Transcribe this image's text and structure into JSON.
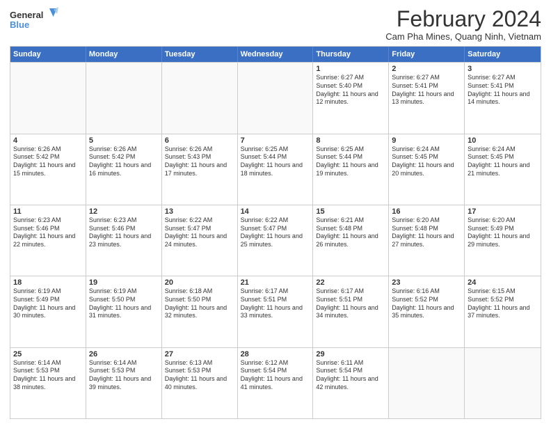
{
  "logo": {
    "line1": "General",
    "line2": "Blue"
  },
  "title": "February 2024",
  "location": "Cam Pha Mines, Quang Ninh, Vietnam",
  "days_of_week": [
    "Sunday",
    "Monday",
    "Tuesday",
    "Wednesday",
    "Thursday",
    "Friday",
    "Saturday"
  ],
  "weeks": [
    [
      {
        "day": "",
        "info": ""
      },
      {
        "day": "",
        "info": ""
      },
      {
        "day": "",
        "info": ""
      },
      {
        "day": "",
        "info": ""
      },
      {
        "day": "1",
        "sunrise": "Sunrise: 6:27 AM",
        "sunset": "Sunset: 5:40 PM",
        "daylight": "Daylight: 11 hours and 12 minutes."
      },
      {
        "day": "2",
        "sunrise": "Sunrise: 6:27 AM",
        "sunset": "Sunset: 5:41 PM",
        "daylight": "Daylight: 11 hours and 13 minutes."
      },
      {
        "day": "3",
        "sunrise": "Sunrise: 6:27 AM",
        "sunset": "Sunset: 5:41 PM",
        "daylight": "Daylight: 11 hours and 14 minutes."
      }
    ],
    [
      {
        "day": "4",
        "sunrise": "Sunrise: 6:26 AM",
        "sunset": "Sunset: 5:42 PM",
        "daylight": "Daylight: 11 hours and 15 minutes."
      },
      {
        "day": "5",
        "sunrise": "Sunrise: 6:26 AM",
        "sunset": "Sunset: 5:42 PM",
        "daylight": "Daylight: 11 hours and 16 minutes."
      },
      {
        "day": "6",
        "sunrise": "Sunrise: 6:26 AM",
        "sunset": "Sunset: 5:43 PM",
        "daylight": "Daylight: 11 hours and 17 minutes."
      },
      {
        "day": "7",
        "sunrise": "Sunrise: 6:25 AM",
        "sunset": "Sunset: 5:44 PM",
        "daylight": "Daylight: 11 hours and 18 minutes."
      },
      {
        "day": "8",
        "sunrise": "Sunrise: 6:25 AM",
        "sunset": "Sunset: 5:44 PM",
        "daylight": "Daylight: 11 hours and 19 minutes."
      },
      {
        "day": "9",
        "sunrise": "Sunrise: 6:24 AM",
        "sunset": "Sunset: 5:45 PM",
        "daylight": "Daylight: 11 hours and 20 minutes."
      },
      {
        "day": "10",
        "sunrise": "Sunrise: 6:24 AM",
        "sunset": "Sunset: 5:45 PM",
        "daylight": "Daylight: 11 hours and 21 minutes."
      }
    ],
    [
      {
        "day": "11",
        "sunrise": "Sunrise: 6:23 AM",
        "sunset": "Sunset: 5:46 PM",
        "daylight": "Daylight: 11 hours and 22 minutes."
      },
      {
        "day": "12",
        "sunrise": "Sunrise: 6:23 AM",
        "sunset": "Sunset: 5:46 PM",
        "daylight": "Daylight: 11 hours and 23 minutes."
      },
      {
        "day": "13",
        "sunrise": "Sunrise: 6:22 AM",
        "sunset": "Sunset: 5:47 PM",
        "daylight": "Daylight: 11 hours and 24 minutes."
      },
      {
        "day": "14",
        "sunrise": "Sunrise: 6:22 AM",
        "sunset": "Sunset: 5:47 PM",
        "daylight": "Daylight: 11 hours and 25 minutes."
      },
      {
        "day": "15",
        "sunrise": "Sunrise: 6:21 AM",
        "sunset": "Sunset: 5:48 PM",
        "daylight": "Daylight: 11 hours and 26 minutes."
      },
      {
        "day": "16",
        "sunrise": "Sunrise: 6:20 AM",
        "sunset": "Sunset: 5:48 PM",
        "daylight": "Daylight: 11 hours and 27 minutes."
      },
      {
        "day": "17",
        "sunrise": "Sunrise: 6:20 AM",
        "sunset": "Sunset: 5:49 PM",
        "daylight": "Daylight: 11 hours and 29 minutes."
      }
    ],
    [
      {
        "day": "18",
        "sunrise": "Sunrise: 6:19 AM",
        "sunset": "Sunset: 5:49 PM",
        "daylight": "Daylight: 11 hours and 30 minutes."
      },
      {
        "day": "19",
        "sunrise": "Sunrise: 6:19 AM",
        "sunset": "Sunset: 5:50 PM",
        "daylight": "Daylight: 11 hours and 31 minutes."
      },
      {
        "day": "20",
        "sunrise": "Sunrise: 6:18 AM",
        "sunset": "Sunset: 5:50 PM",
        "daylight": "Daylight: 11 hours and 32 minutes."
      },
      {
        "day": "21",
        "sunrise": "Sunrise: 6:17 AM",
        "sunset": "Sunset: 5:51 PM",
        "daylight": "Daylight: 11 hours and 33 minutes."
      },
      {
        "day": "22",
        "sunrise": "Sunrise: 6:17 AM",
        "sunset": "Sunset: 5:51 PM",
        "daylight": "Daylight: 11 hours and 34 minutes."
      },
      {
        "day": "23",
        "sunrise": "Sunrise: 6:16 AM",
        "sunset": "Sunset: 5:52 PM",
        "daylight": "Daylight: 11 hours and 35 minutes."
      },
      {
        "day": "24",
        "sunrise": "Sunrise: 6:15 AM",
        "sunset": "Sunset: 5:52 PM",
        "daylight": "Daylight: 11 hours and 37 minutes."
      }
    ],
    [
      {
        "day": "25",
        "sunrise": "Sunrise: 6:14 AM",
        "sunset": "Sunset: 5:53 PM",
        "daylight": "Daylight: 11 hours and 38 minutes."
      },
      {
        "day": "26",
        "sunrise": "Sunrise: 6:14 AM",
        "sunset": "Sunset: 5:53 PM",
        "daylight": "Daylight: 11 hours and 39 minutes."
      },
      {
        "day": "27",
        "sunrise": "Sunrise: 6:13 AM",
        "sunset": "Sunset: 5:53 PM",
        "daylight": "Daylight: 11 hours and 40 minutes."
      },
      {
        "day": "28",
        "sunrise": "Sunrise: 6:12 AM",
        "sunset": "Sunset: 5:54 PM",
        "daylight": "Daylight: 11 hours and 41 minutes."
      },
      {
        "day": "29",
        "sunrise": "Sunrise: 6:11 AM",
        "sunset": "Sunset: 5:54 PM",
        "daylight": "Daylight: 11 hours and 42 minutes."
      },
      {
        "day": "",
        "info": ""
      },
      {
        "day": "",
        "info": ""
      }
    ]
  ]
}
